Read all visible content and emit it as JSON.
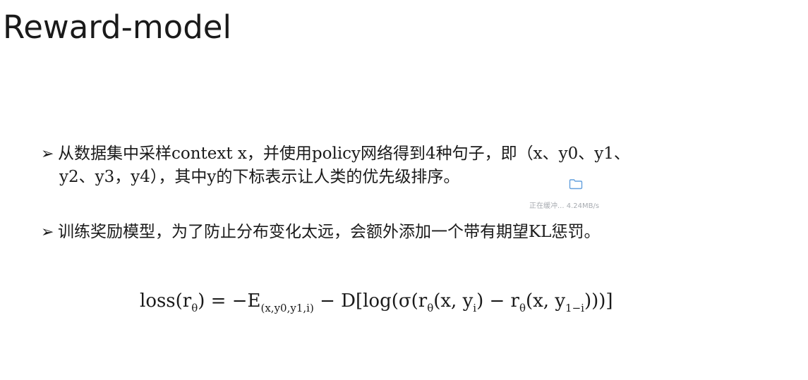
{
  "slide": {
    "title": "Reward-model",
    "bullets": [
      {
        "line1": "从数据集中采样context x，并使用policy网络得到4种句子，即（x、y0、y1、",
        "line2": "y2、y3，y4），其中y的下标表示让人类的优先级排序。"
      },
      {
        "line1": "训练奖励模型，为了防止分布变化太远，会额外添加一个带有期望KL惩罚。"
      }
    ],
    "bullet_marker": "➢",
    "formula": {
      "lhs": "loss(r",
      "theta": "θ",
      "eq_part": ") = −E",
      "expect_sub": "(x,y0,y1,i)",
      "rhs_a": " − D[log(σ(r",
      "rhs_b": "(x, y",
      "yi_sub": "i",
      "rhs_c": ") − r",
      "rhs_d": "(x, y",
      "y1i_sub": "1−i",
      "rhs_e": ")))]"
    }
  },
  "overlay": {
    "status_text": "正在缓冲... 4.24MB/s",
    "icon": "folder-icon",
    "color": "#4a90d9"
  }
}
